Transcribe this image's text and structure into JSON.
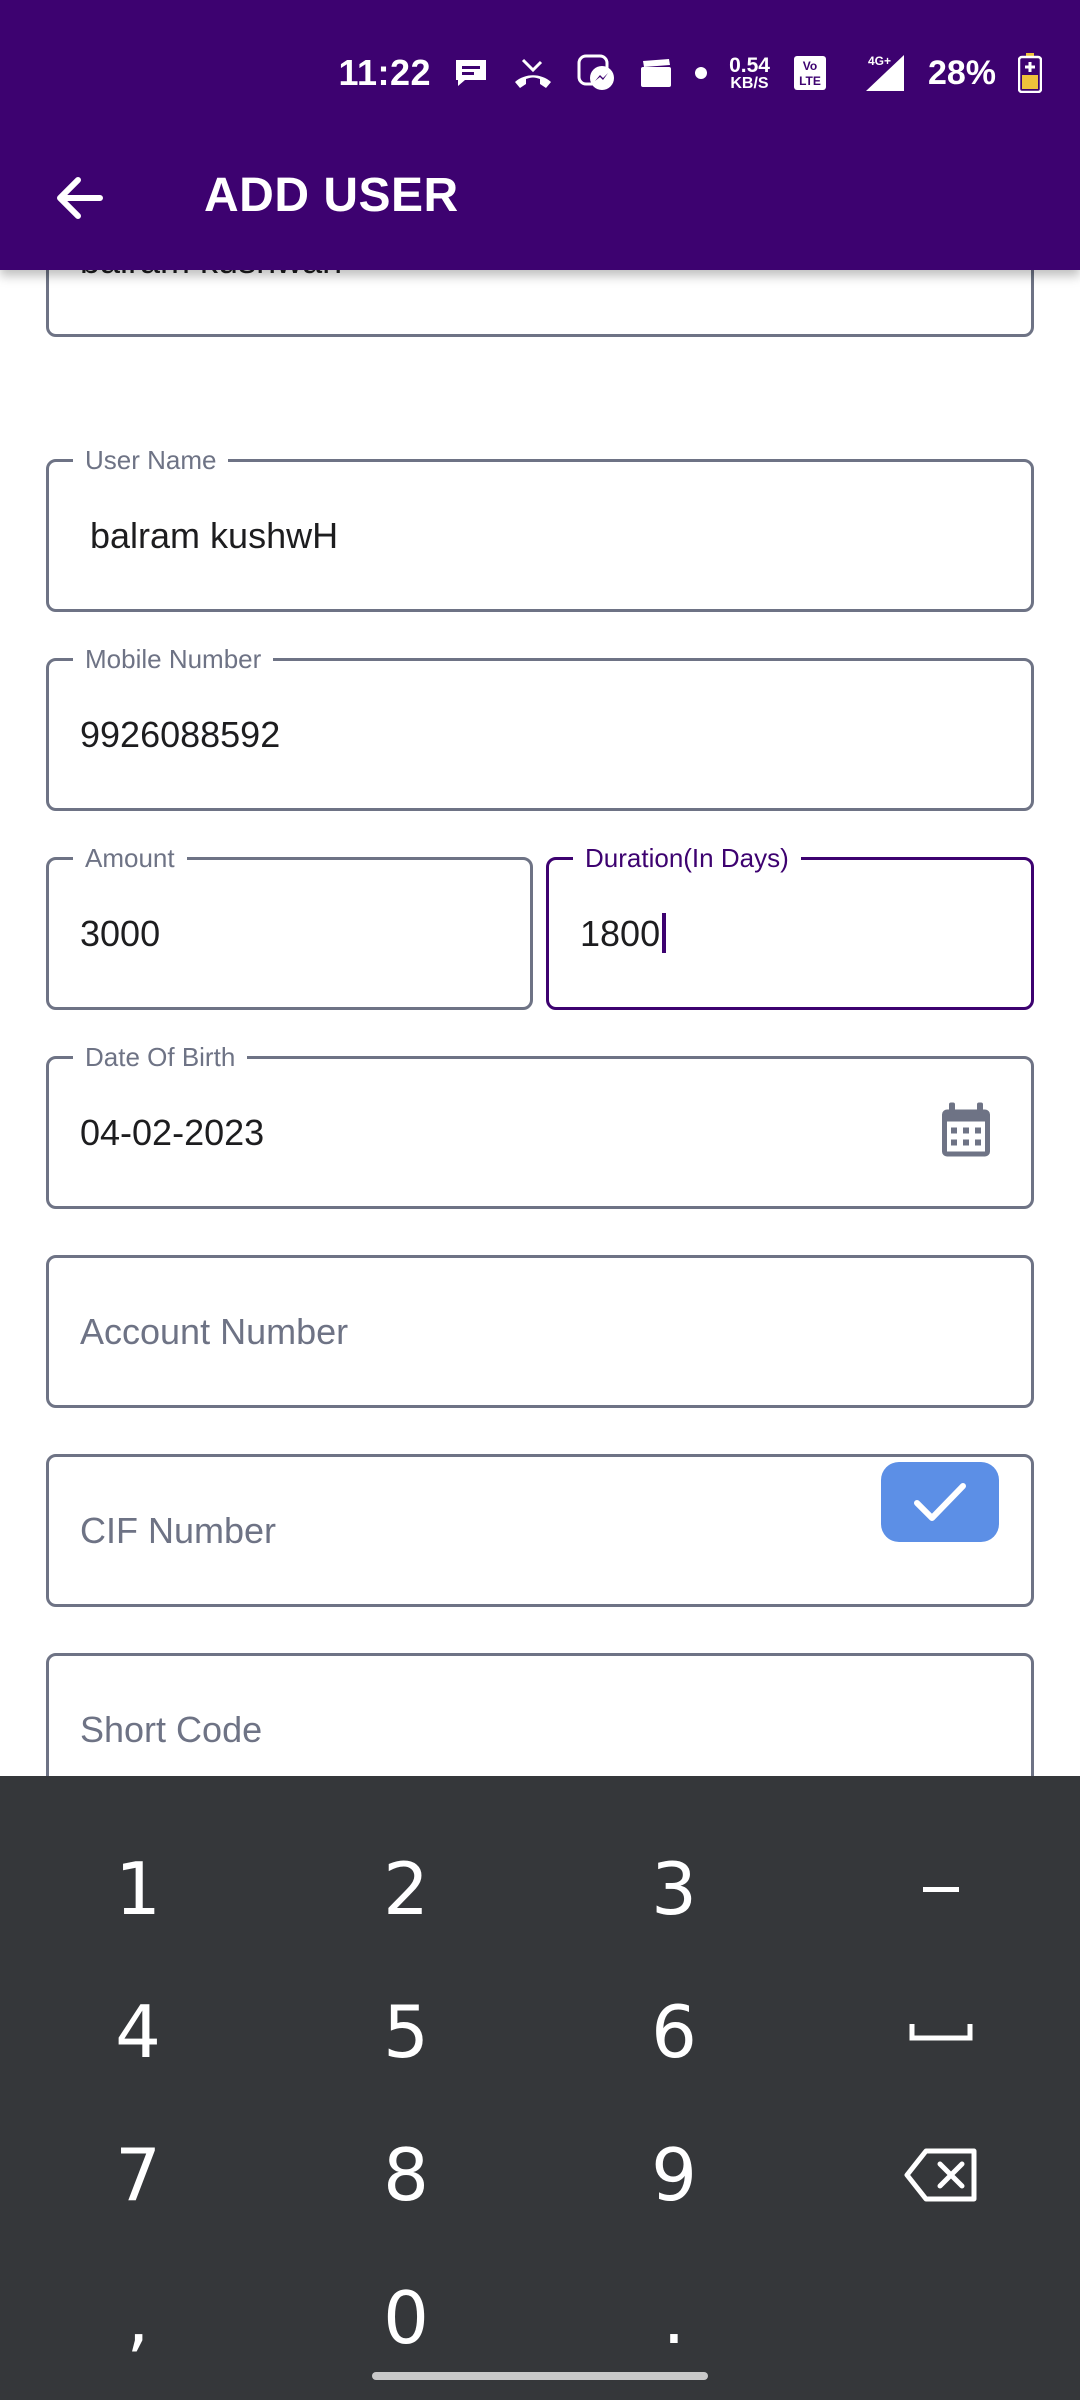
{
  "status_bar": {
    "time": "11:22",
    "net_speed_value": "0.54",
    "net_speed_unit": "KB/S",
    "volte": "Vo LTE",
    "network": "4G+",
    "battery": "28%",
    "icons": [
      "message-icon",
      "missed-call-icon",
      "messenger-icon",
      "clapper-icon",
      "dot-icon",
      "volte-icon",
      "signal-icon",
      "battery-charging-icon"
    ]
  },
  "app_bar": {
    "title": "ADD USER",
    "back_icon": "arrow-left-icon"
  },
  "form": {
    "full_name": {
      "value": "balram kushwah"
    },
    "user_name": {
      "label": "User Name",
      "value": " balram kushwH"
    },
    "mobile": {
      "label": "Mobile Number",
      "value": "9926088592"
    },
    "amount": {
      "label": "Amount",
      "value": "3000"
    },
    "duration": {
      "label": "Duration(In Days)",
      "value": "1800"
    },
    "dob": {
      "label": "Date Of Birth",
      "value": "04-02-2023",
      "icon": "calendar-icon"
    },
    "account_number": {
      "placeholder": "Account Number"
    },
    "cif_number": {
      "placeholder": "CIF Number"
    },
    "short_code": {
      "placeholder": "Short Code"
    }
  },
  "keyboard": {
    "row1": [
      "1",
      "2",
      "3",
      "−"
    ],
    "row2": [
      "4",
      "5",
      "6",
      "space"
    ],
    "row3": [
      "7",
      "8",
      "9",
      "backspace"
    ],
    "row4": [
      ",",
      "0",
      ".",
      "done"
    ],
    "accent": "#5c8fe6",
    "background": "#35373a"
  },
  "colors": {
    "primary": "#3d0270",
    "border": "#6e7385"
  }
}
